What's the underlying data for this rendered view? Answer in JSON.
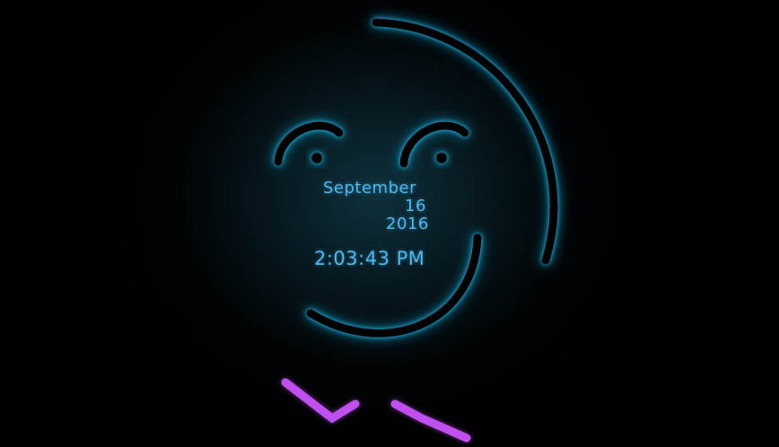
{
  "clock": {
    "month": "September",
    "day": "16",
    "year": "2016",
    "time": "2:03:43 PM"
  },
  "colors": {
    "background": "#000000",
    "text": "#4cb8ee",
    "face_glow": "#22c8ff",
    "bowtie": "#c050f0",
    "tie_center": "#66ee44"
  }
}
